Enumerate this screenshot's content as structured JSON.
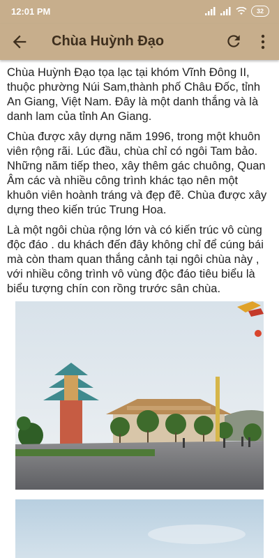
{
  "status_bar": {
    "time": "12:01 PM",
    "battery": "32"
  },
  "app_bar": {
    "title": "Chùa Huỳnh Đạo",
    "back_icon": "arrow-left-icon",
    "refresh_icon": "refresh-icon",
    "more_icon": "more-vertical-icon"
  },
  "article": {
    "paragraphs": [
      "Chùa Huỳnh Đạo tọa lạc tại khóm Vĩnh Đông II, thuộc phường Núi Sam,thành phố Châu Đốc, tỉnh An Giang, Việt Nam. Đây là một danh thắng và là danh lam của tỉnh An Giang.",
      "Chùa được xây dựng năm 1996, trong một khuôn viên rộng rãi. Lúc đầu, chùa chỉ có ngôi Tam bảo. Những năm tiếp theo, xây thêm gác chuông, Quan Âm các và nhiều công trình khác tạo nên một khuôn viên hoành tráng và đẹp đẽ. Chùa được xây dựng theo kiến trúc Trung Hoa.",
      "Là một ngôi chùa rộng lớn và có kiến trúc vô cùng độc đáo . du khách đến đây không chỉ để cúng bái mà còn tham quan thắng cảnh tại ngôi chùa này , với nhiều công trình vô vùng độc đáo tiêu biểu là biểu tượng chín con rồng trước sân chùa."
    ]
  },
  "colors": {
    "app_bar": "#c7ae8c",
    "title_text": "#3d2e1d",
    "body_text": "#222222"
  }
}
